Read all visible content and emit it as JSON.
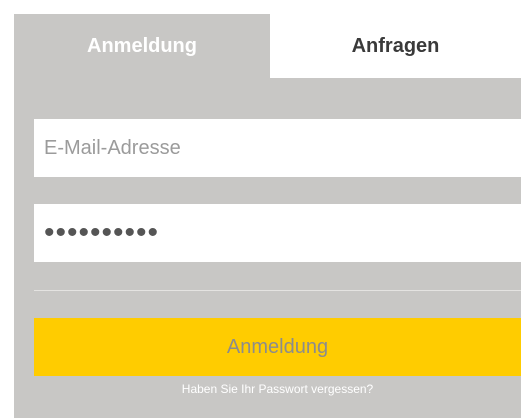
{
  "tabs": {
    "login_label": "Anmeldung",
    "requests_label": "Anfragen",
    "active": "login"
  },
  "form": {
    "email_placeholder": "E-Mail-Adresse",
    "email_value": "",
    "password_value": "••••••••••",
    "submit_label": "Anmeldung",
    "forgot_password_label": "Haben Sie Ihr Passwort vergessen?"
  },
  "colors": {
    "panel_background": "#c8c7c5",
    "accent_button": "#ffcc00",
    "tab_inactive_background": "#ffffff",
    "button_text": "#8c8c8c"
  }
}
